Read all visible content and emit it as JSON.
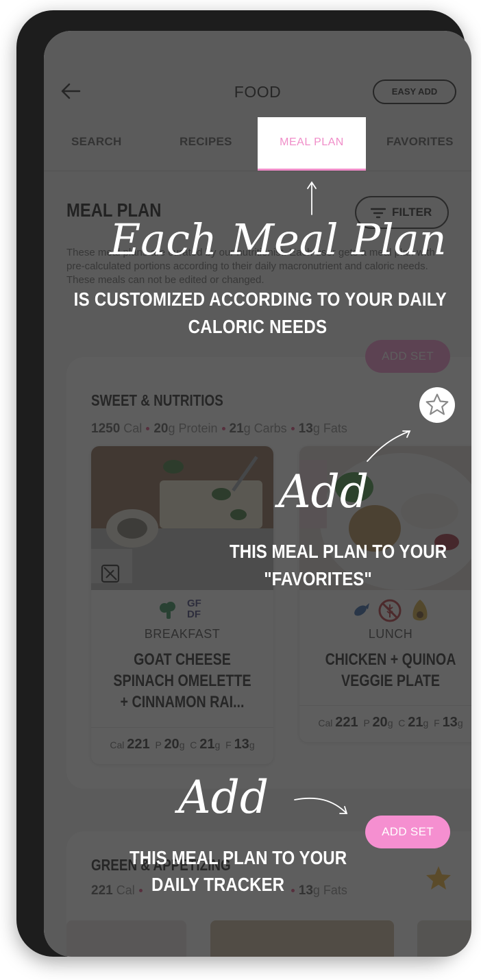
{
  "header": {
    "title": "FOOD",
    "easy_add_label": "EASY ADD"
  },
  "tabs": [
    {
      "label": "SEARCH"
    },
    {
      "label": "RECIPES"
    },
    {
      "label": "MEAL PLAN",
      "active": true
    },
    {
      "label": "FAVORITES"
    }
  ],
  "section": {
    "title": "MEAL PLAN",
    "filter_label": "FILTER",
    "description": "These meal plans are curated by our nutritionist. Each user gets a meal plan with pre-calculated portions according to their daily macronutrient and caloric needs. These meals can not be edited or changed."
  },
  "set1": {
    "title": "SWEET & NUTRITIOS",
    "cal": "1250",
    "cal_unit": "Cal",
    "protein": "20",
    "protein_unit": "g Protein",
    "carbs": "21",
    "carbs_unit": "g Carbs",
    "fats": "13",
    "fats_unit": "g Fats",
    "add_set_label": "ADD SET",
    "meals": [
      {
        "type": "BREAKFAST",
        "name": "GOAT CHEESE SPINACH OMELETTE + CINNAMON RAI...",
        "diet_badge": "GF\nDF",
        "cal_label": "Cal",
        "cal": "221",
        "p_label": "P",
        "p": "20",
        "c_label": "C",
        "c": "21",
        "f_label": "F",
        "f": "13",
        "unit": "g"
      },
      {
        "type": "LUNCH",
        "name": "CHICKEN + QUINOA VEGGIE PLATE",
        "cal_label": "Cal",
        "cal": "221",
        "p_label": "P",
        "p": "20",
        "c_label": "C",
        "c": "21",
        "f_label": "F",
        "f": "13",
        "unit": "g"
      }
    ]
  },
  "set2": {
    "title": "GREEN & APPETIZING",
    "cal": "221",
    "cal_unit": "Cal",
    "fats": "13",
    "fats_unit": "g Fats"
  },
  "overlay": {
    "script1": "Each Meal Plan",
    "caption1_line1": "IS CUSTOMIZED ACCORDING TO YOUR DAILY",
    "caption1_line2": "CALORIC NEEDS",
    "script2": "Add",
    "caption2_line1": "THIS MEAL PLAN TO YOUR",
    "caption2_line2": "\"FAVORITES\"",
    "script3": "Add",
    "caption3_line1": "THIS MEAL PLAN TO YOUR",
    "caption3_line2": "DAILY TRACKER",
    "add_set_label": "ADD SET"
  },
  "colors": {
    "accent_pink": "#f08ec9",
    "button_pink": "#f58fd0",
    "dot_red": "#e0457c",
    "star_gold": "#f2b233"
  },
  "icons": [
    "back-arrow-icon",
    "filter-icon",
    "star-outline-icon",
    "star-filled-icon",
    "broccoli-icon",
    "fish-icon",
    "no-wheat-icon",
    "avocado-icon",
    "edit-off-icon"
  ]
}
